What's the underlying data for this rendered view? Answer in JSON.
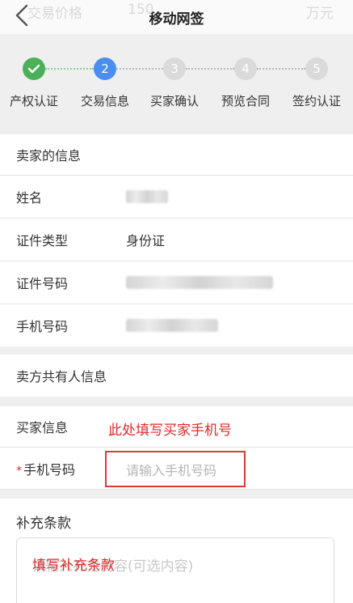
{
  "nav": {
    "title": "移动网签",
    "ghost_left": "交易价格",
    "ghost_mid": "150",
    "ghost_right": "万元"
  },
  "steps": [
    {
      "number": "✓",
      "label": "产权认证",
      "state": "done",
      "color": "#4cb05a"
    },
    {
      "number": "2",
      "label": "交易信息",
      "state": "active",
      "color": "#4a8ff0"
    },
    {
      "number": "3",
      "label": "买家确认",
      "state": "pending",
      "color": "#dadada"
    },
    {
      "number": "4",
      "label": "预览合同",
      "state": "pending",
      "color": "#dadada"
    },
    {
      "number": "5",
      "label": "签约认证",
      "state": "pending",
      "color": "#dadada"
    }
  ],
  "seller": {
    "section_title": "卖家的信息",
    "name_label": "姓名",
    "id_type_label": "证件类型",
    "id_type_value": "身份证",
    "id_number_label": "证件号码",
    "phone_label": "手机号码"
  },
  "co_owner": {
    "section_title": "卖方共有人信息"
  },
  "buyer": {
    "section_title": "买家信息",
    "annotation": "此处填写买家手机号",
    "required_mark": "*",
    "phone_label": "手机号码",
    "phone_placeholder": "请输入手机号码"
  },
  "supplement": {
    "section_title": "补充条款",
    "placeholder": "请输入补充内容(可选内容)",
    "annotation": "填写补充条款"
  },
  "colors": {
    "done": "#4cb05a",
    "active": "#4a8ff0",
    "pending": "#dadada",
    "annotation": "#e02a2a"
  }
}
